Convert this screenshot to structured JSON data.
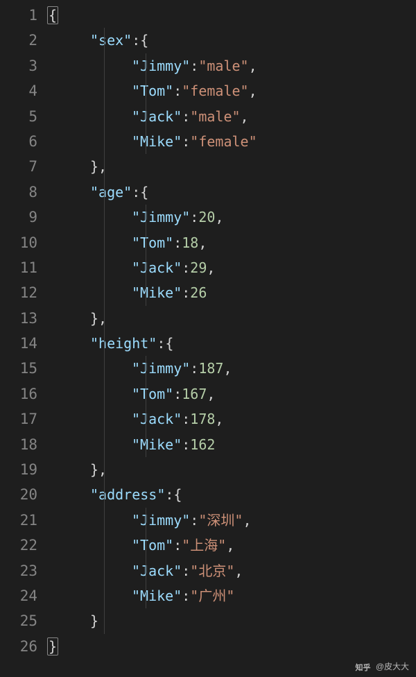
{
  "lineNumbers": [
    "1",
    "2",
    "3",
    "4",
    "5",
    "6",
    "7",
    "8",
    "9",
    "10",
    "11",
    "12",
    "13",
    "14",
    "15",
    "16",
    "17",
    "18",
    "19",
    "20",
    "21",
    "22",
    "23",
    "24",
    "25",
    "26"
  ],
  "lines": {
    "l1": {
      "brace": "{"
    },
    "l2": {
      "key": "\"sex\"",
      "colon": ":",
      "brace": "{"
    },
    "l3": {
      "key": "\"Jimmy\"",
      "colon": ":",
      "val": "\"male\"",
      "comma": ","
    },
    "l4": {
      "key": "\"Tom\"",
      "colon": ":",
      "val": "\"female\"",
      "comma": ","
    },
    "l5": {
      "key": "\"Jack\"",
      "colon": ":",
      "val": "\"male\"",
      "comma": ","
    },
    "l6": {
      "key": "\"Mike\"",
      "colon": ":",
      "val": "\"female\""
    },
    "l7": {
      "brace": "}",
      "comma": ","
    },
    "l8": {
      "key": "\"age\"",
      "colon": ":",
      "brace": "{"
    },
    "l9": {
      "key": "\"Jimmy\"",
      "colon": ":",
      "val": "20",
      "comma": ","
    },
    "l10": {
      "key": "\"Tom\"",
      "colon": ":",
      "val": "18",
      "comma": ","
    },
    "l11": {
      "key": "\"Jack\"",
      "colon": ":",
      "val": "29",
      "comma": ","
    },
    "l12": {
      "key": "\"Mike\"",
      "colon": ":",
      "val": "26"
    },
    "l13": {
      "brace": "}",
      "comma": ","
    },
    "l14": {
      "key": "\"height\"",
      "colon": ":",
      "brace": "{"
    },
    "l15": {
      "key": "\"Jimmy\"",
      "colon": ":",
      "val": "187",
      "comma": ","
    },
    "l16": {
      "key": "\"Tom\"",
      "colon": ":",
      "val": "167",
      "comma": ","
    },
    "l17": {
      "key": "\"Jack\"",
      "colon": ":",
      "val": "178",
      "comma": ","
    },
    "l18": {
      "key": "\"Mike\"",
      "colon": ":",
      "val": "162"
    },
    "l19": {
      "brace": "}",
      "comma": ","
    },
    "l20": {
      "key": "\"address\"",
      "colon": ":",
      "brace": "{"
    },
    "l21": {
      "key": "\"Jimmy\"",
      "colon": ":",
      "val": "\"深圳\"",
      "comma": ","
    },
    "l22": {
      "key": "\"Tom\"",
      "colon": ":",
      "val": "\"上海\"",
      "comma": ","
    },
    "l23": {
      "key": "\"Jack\"",
      "colon": ":",
      "val": "\"北京\"",
      "comma": ","
    },
    "l24": {
      "key": "\"Mike\"",
      "colon": ":",
      "val": "\"广州\""
    },
    "l25": {
      "brace": "}"
    },
    "l26": {
      "brace": "}"
    }
  },
  "watermark": {
    "logo": "知乎",
    "author": "@皮大大"
  }
}
